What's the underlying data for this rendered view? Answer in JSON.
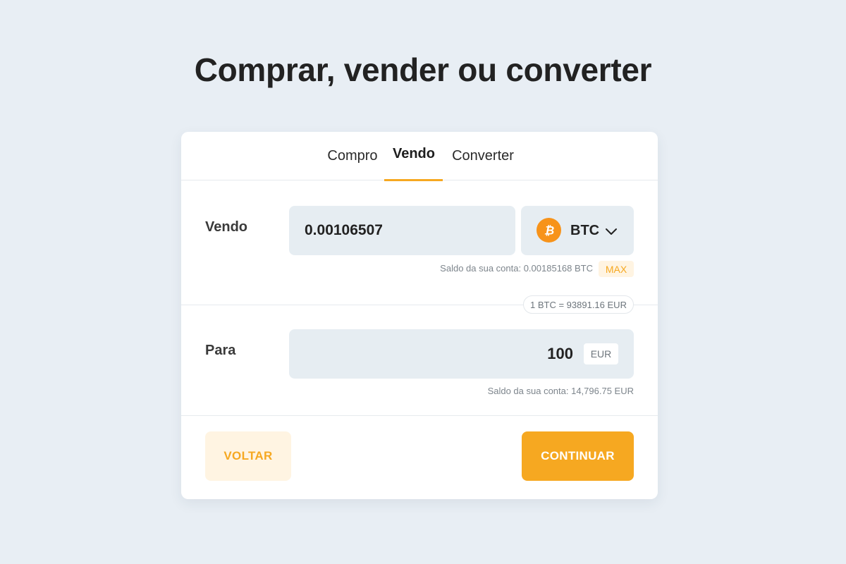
{
  "page": {
    "title": "Comprar, vender ou converter"
  },
  "tabs": [
    {
      "label": "Compro",
      "active": false
    },
    {
      "label": "Vendo",
      "active": true
    },
    {
      "label": "Converter",
      "active": false
    }
  ],
  "sell": {
    "label": "Vendo",
    "amount": "0.00106507",
    "coin": "BTC",
    "coin_icon": "bitcoin-icon",
    "balance_text": "Saldo da sua conta: 0.00185168 BTC",
    "max_label": "MAX"
  },
  "rate": {
    "text": "1 BTC = 93891.16 EUR"
  },
  "receive": {
    "label": "Para",
    "amount": "100",
    "currency": "EUR",
    "balance_text": "Saldo da sua conta: 14,796.75 EUR"
  },
  "actions": {
    "back_label": "VOLTAR",
    "continue_label": "CONTINUAR"
  },
  "colors": {
    "accent": "#f6a821",
    "accent_soft": "#fff4e2",
    "bitcoin": "#f7931a",
    "background": "#e8eef4",
    "field": "#e6edf2"
  }
}
